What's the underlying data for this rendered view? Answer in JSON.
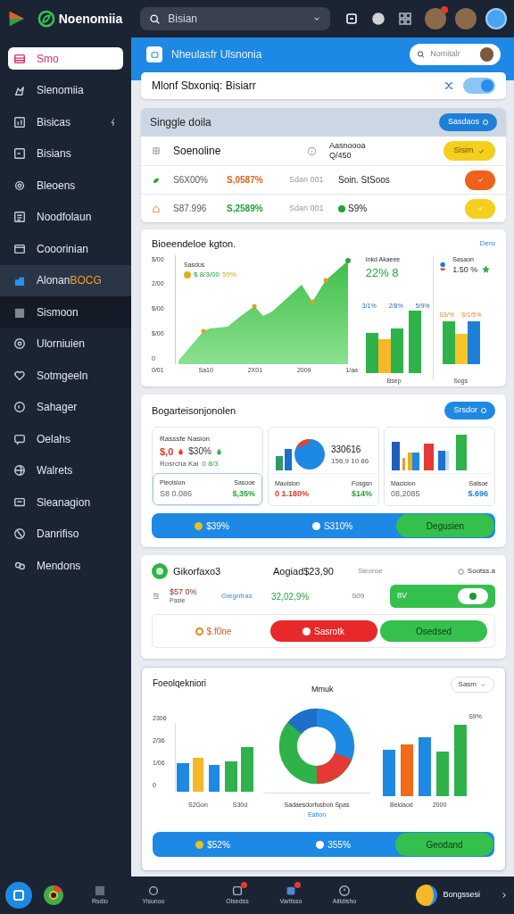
{
  "app": {
    "name": "Noenomiia"
  },
  "search": {
    "value": "Bisian"
  },
  "topbar": {
    "avatars": [
      {
        "badge": true
      },
      {
        "badge": false
      },
      {
        "badge": false
      }
    ]
  },
  "sidebar": {
    "items": [
      {
        "label": "Smo",
        "selected": true
      },
      {
        "label": "Slenomiia",
        "selected": false
      },
      {
        "label": "Bisicas",
        "selected": false,
        "shortcut": true
      },
      {
        "label": "Bisians",
        "selected": false
      },
      {
        "label": "Bleoens",
        "selected": false
      },
      {
        "label": "Noodfolaun",
        "selected": false
      },
      {
        "label": "Cooorinian",
        "selected": false
      },
      {
        "label": "Alonan",
        "tag": "BOCG",
        "selected": false,
        "hovered": true
      },
      {
        "label": "Sismoon",
        "selected": false,
        "pressed": true
      },
      {
        "label": "Ulorniuien",
        "selected": false
      },
      {
        "label": "Sotmgeeln",
        "selected": false
      },
      {
        "label": "Sahager",
        "selected": false
      },
      {
        "label": "Oelahs",
        "selected": false
      },
      {
        "label": "Walrets",
        "selected": false
      },
      {
        "label": "Sleanagion",
        "selected": false
      },
      {
        "label": "Danrifiso",
        "selected": false
      },
      {
        "label": "Mendons",
        "selected": false
      }
    ]
  },
  "header": {
    "title": "Nheulasfr Ulsnonia",
    "search_placeholder": "Nomitalr"
  },
  "banner": {
    "title": "Mlonf Sbxoniq: Bisiarr",
    "toggle_on": true
  },
  "table_card": {
    "title": "Singgle doila",
    "button": "Sasdaos",
    "rows": [
      {
        "kind": "header",
        "name": "Soenoline",
        "detail": [
          "Aasnoooa",
          "Q/450"
        ],
        "color": "#f5cf1d",
        "status_label": "Sisim"
      },
      {
        "kind": "value",
        "amount": "S6X00%",
        "change": {
          "text": "S,0587%",
          "color": "#e0621a"
        },
        "period": "Sdan 001",
        "note": "Soin. StSoos",
        "color": "#f0621b"
      },
      {
        "kind": "value",
        "amount": "S87.996",
        "change": {
          "text": "S,2589%",
          "color": "#22a33a"
        },
        "period": "Sdan 001",
        "note": "S9%",
        "note_dot": true,
        "color": "#f5cf1d"
      }
    ]
  },
  "chart_card": {
    "title": "Bioeendeloe kgton.",
    "link": "Dero",
    "yticks": [
      "$/00",
      "2/00",
      "$/00",
      "$/00",
      "0"
    ],
    "xlabels": [
      "0/01",
      "Sa10",
      "2X01",
      "2009",
      "1/aa"
    ],
    "legend_label": "Sasdos",
    "legend_value": "$ 8/3/00",
    "legend_pct": "59%",
    "middle": {
      "label": "Inkd Akaeee",
      "value": "22% 8",
      "bar_labels": [
        "3/1%",
        "2/8%",
        "5/9%"
      ],
      "xlabel": "Bsep"
    },
    "right": {
      "label": "Sasaon",
      "value": "1.50 %",
      "bar_labels": [
        "S3/%",
        "S/1/5%"
      ],
      "xlabel": "Sogs"
    }
  },
  "summary_card": {
    "title": "Bogarteisonjonolen",
    "button": "Srsdor",
    "tiles": [
      {
        "kind": "stats",
        "label": "Rasssfe Nasion",
        "value": "$,0",
        "pct": "$30%",
        "sub_label": "Rosrcha Kai",
        "sub_value": "0 8/3",
        "foot_left_label": "Pleolsion",
        "foot_right_label": "Sasooe",
        "foot_left": {
          "text": "S8 0.086"
        },
        "foot_right": {
          "text": "$,35%",
          "color": "#22a33a"
        },
        "outlined": true
      },
      {
        "kind": "donut",
        "value": "330616",
        "sub": "156,9 10 86",
        "foot_left_label": "Maoision",
        "foot_right_label": "Fosgsn",
        "foot_left": {
          "text": "0 1.180%",
          "color": "#d83a2a"
        },
        "foot_right": {
          "text": "$14%",
          "color": "#22a33a"
        },
        "outlined": false
      },
      {
        "kind": "bars",
        "foot_left_label": "Macicion",
        "foot_right_label": "Salsoe",
        "foot_left": {
          "text": "08,2085"
        },
        "foot_right": {
          "text": "$.696",
          "color": "#1e7fd8"
        },
        "outlined": false
      }
    ],
    "bar": {
      "first": "$39%",
      "second": "S310%",
      "button": "Degusien"
    }
  },
  "order_card": {
    "name": "Gikorfaxo3",
    "amount": "Aogiad$23,90",
    "state": "Sieoroe",
    "link": "Sootss.a",
    "price": "$57 0%",
    "price_sub": "Pasie",
    "category": "Giegnfras",
    "change": "32,02,9%",
    "qty": "S09",
    "switch_label": "8V",
    "switch_on": true,
    "actions": [
      {
        "kind": "text",
        "label": "$.f0ne"
      },
      {
        "kind": "danger",
        "label": "Sasrotk"
      },
      {
        "kind": "success",
        "label": "Osedsed"
      }
    ]
  },
  "report_card": {
    "title": "Foeolqekniori",
    "center_title": "Mmuk",
    "dropdown": "Sasm",
    "yticks": [
      "2306",
      "2/36",
      "1/06",
      "0"
    ],
    "left_xlabels": [
      "S2Gon",
      "S30d"
    ],
    "donut_label": "Sadaesdorfusbon Spas",
    "donut_link": "Eabon",
    "right_top": "S9%",
    "right_xlabels": [
      "Beldaod",
      "2000"
    ],
    "bar": {
      "first": "$52%",
      "second": "355%",
      "button": "Geodand"
    }
  },
  "taskbar": {
    "items": [
      {
        "label": "Rsdio",
        "badge": false
      },
      {
        "label": "Yisunoo",
        "badge": false
      },
      {
        "label": "Oisedss",
        "badge": true
      },
      {
        "label": "Varitsso",
        "badge": true
      },
      {
        "label": "Alitdisho",
        "badge": false
      }
    ],
    "user": "Bongssesi"
  }
}
